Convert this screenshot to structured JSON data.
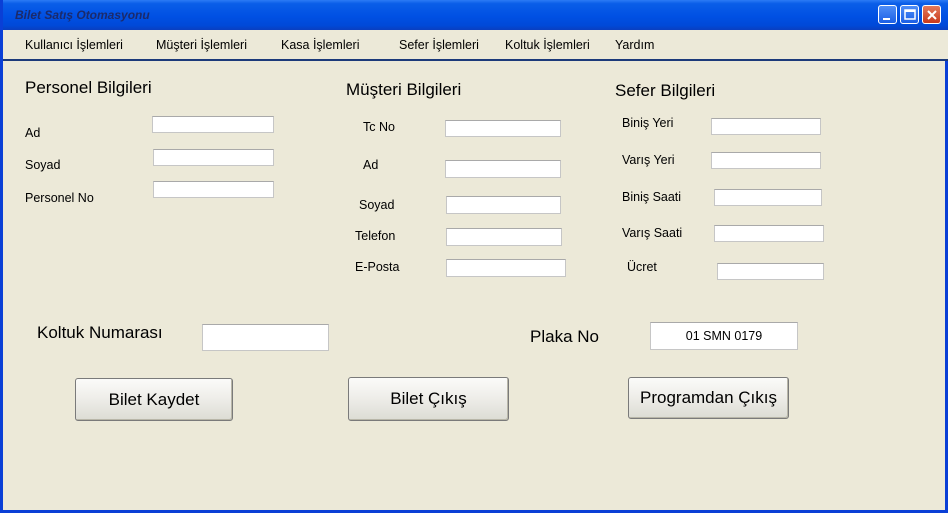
{
  "window": {
    "title": "Bilet Satış Otomasyonu"
  },
  "menu": [
    "Kullanıcı İşlemleri",
    "Müşteri İşlemleri",
    "Kasa İşlemleri",
    "Sefer İşlemleri",
    "Koltuk İşlemleri",
    "Yardım"
  ],
  "personel": {
    "heading": "Personel Bilgileri",
    "ad_label": "Ad",
    "soyad_label": "Soyad",
    "no_label": "Personel No",
    "ad_value": "",
    "soyad_value": "",
    "no_value": ""
  },
  "musteri": {
    "heading": "Müşteri Bilgileri",
    "tc_label": "Tc No",
    "ad_label": "Ad",
    "soyad_label": "Soyad",
    "telefon_label": "Telefon",
    "eposta_label": "E-Posta",
    "tc_value": "",
    "ad_value": "",
    "soyad_value": "",
    "telefon_value": "",
    "eposta_value": ""
  },
  "sefer": {
    "heading": "Sefer Bilgileri",
    "binis_yeri_label": "Biniş Yeri",
    "varis_yeri_label": "Varış Yeri",
    "binis_saati_label": "Biniş Saati",
    "varis_saati_label": "Varış Saati",
    "ucret_label": "Ücret",
    "binis_yeri_value": "",
    "varis_yeri_value": "",
    "binis_saati_value": "",
    "varis_saati_value": "",
    "ucret_value": ""
  },
  "koltuk": {
    "label": "Koltuk Numarası",
    "value": ""
  },
  "plaka": {
    "label": "Plaka No",
    "value": "01 SMN 0179"
  },
  "buttons": {
    "kaydet": "Bilet Kaydet",
    "cikis": "Bilet Çıkış",
    "program_cikis": "Programdan Çıkış"
  },
  "colors": {
    "titlebar": "#0050e3",
    "window_bg": "#ece9d8",
    "frame": "#0a3fd6"
  }
}
